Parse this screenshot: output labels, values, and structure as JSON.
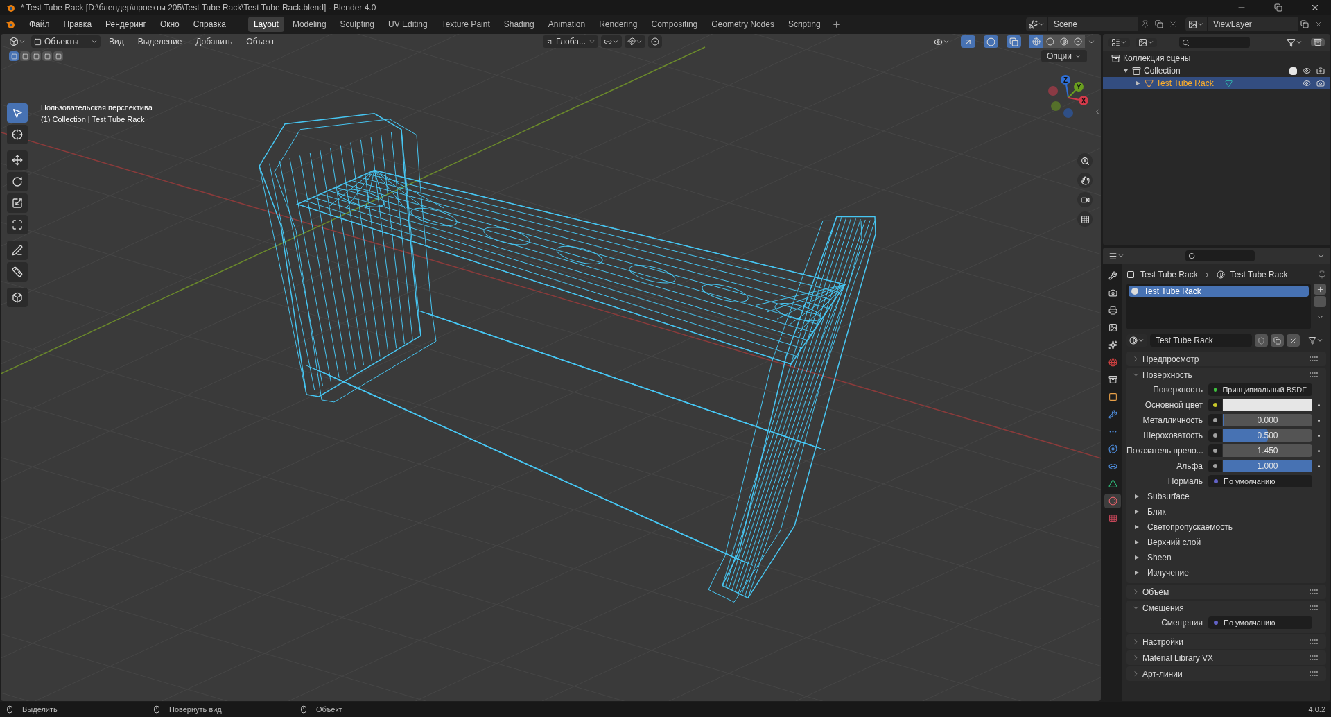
{
  "window": {
    "title": "* Test Tube Rack [D:\\блендер\\проекты 205\\Test Tube Rack\\Test Tube Rack.blend] - Blender 4.0"
  },
  "menu": [
    "Файл",
    "Правка",
    "Рендеринг",
    "Окно",
    "Справка"
  ],
  "workspaces": [
    {
      "label": "Layout",
      "selected": true
    },
    {
      "label": "Modeling",
      "selected": false
    },
    {
      "label": "Sculpting",
      "selected": false
    },
    {
      "label": "UV Editing",
      "selected": false
    },
    {
      "label": "Texture Paint",
      "selected": false
    },
    {
      "label": "Shading",
      "selected": false
    },
    {
      "label": "Animation",
      "selected": false
    },
    {
      "label": "Rendering",
      "selected": false
    },
    {
      "label": "Compositing",
      "selected": false
    },
    {
      "label": "Geometry Nodes",
      "selected": false
    },
    {
      "label": "Scripting",
      "selected": false
    }
  ],
  "scene": "Scene",
  "view_layer": "ViewLayer",
  "viewport": {
    "mode": "Объекты",
    "menus": [
      "Вид",
      "Выделение",
      "Добавить",
      "Объект"
    ],
    "orientation": "Глоба...",
    "options": "Опции",
    "toggles": [
      {
        "kind": "gizmo",
        "on": true
      },
      {
        "kind": "overlay",
        "on": true
      },
      {
        "kind": "xray",
        "on": true
      }
    ],
    "select_modes": [
      {
        "selected": true
      },
      {
        "selected": false
      },
      {
        "selected": false
      },
      {
        "selected": false
      },
      {
        "selected": false
      }
    ],
    "shading_modes": [
      {
        "kind": "wireframe",
        "selected": true
      },
      {
        "kind": "solid",
        "selected": false
      },
      {
        "kind": "material",
        "selected": false
      },
      {
        "kind": "rendered",
        "selected": false
      }
    ],
    "overlay_lines": [
      "Пользовательская перспектива",
      "(1) Collection | Test Tube Rack"
    ],
    "gizmo": {
      "x": "X",
      "y": "Y",
      "z": "Z"
    }
  },
  "tools": [
    {
      "kind": "select",
      "selected": true
    },
    {
      "kind": "cursor",
      "selected": false
    },
    {
      "kind": "move",
      "selected": false
    },
    {
      "kind": "rotate",
      "selected": false
    },
    {
      "kind": "scale",
      "selected": false
    },
    {
      "kind": "transform",
      "selected": false
    },
    {
      "kind": "annotate",
      "selected": false
    },
    {
      "kind": "measure",
      "selected": false
    },
    {
      "kind": "add",
      "selected": false
    }
  ],
  "outliner": {
    "root": "Коллекция сцены",
    "children": [
      {
        "label": "Collection",
        "selected": false,
        "expanded": true,
        "checked": true,
        "children": [
          {
            "label": "Test Tube Rack",
            "selected": true,
            "expanded": false
          }
        ]
      }
    ]
  },
  "properties": {
    "tabs": [
      {
        "kind": "tool",
        "selected": false
      },
      {
        "kind": "render",
        "selected": false
      },
      {
        "kind": "output",
        "selected": false
      },
      {
        "kind": "view_layer",
        "selected": false
      },
      {
        "kind": "scene",
        "selected": false
      },
      {
        "kind": "world",
        "selected": false
      },
      {
        "kind": "collection",
        "selected": false
      },
      {
        "kind": "object",
        "selected": false
      },
      {
        "kind": "modifiers",
        "selected": false
      },
      {
        "kind": "particles",
        "selected": false
      },
      {
        "kind": "physics",
        "selected": false
      },
      {
        "kind": "constraints",
        "selected": false
      },
      {
        "kind": "data",
        "selected": false
      },
      {
        "kind": "material",
        "selected": true
      },
      {
        "kind": "texture",
        "selected": false
      }
    ],
    "breadcrumb": [
      "Test Tube Rack",
      "Test Tube Rack"
    ],
    "slots": [
      {
        "label": "Test Tube Rack",
        "selected": true
      }
    ],
    "material": "Test Tube Rack",
    "panels": [
      {
        "title": "Предпросмотр",
        "expanded": false
      },
      {
        "title": "Поверхность",
        "expanded": true,
        "rows": [
          {
            "kind": "link",
            "color": "#3fc23f",
            "label": "Поверхность",
            "value": "Принципиальный BSDF"
          },
          {
            "kind": "swatch",
            "color": "#c7c729",
            "label": "Основной цвет",
            "swatch": {
              "color": "#e6e6e6"
            }
          },
          {
            "kind": "slider",
            "color": "#a1a1a1",
            "label": "Металличность",
            "value": "0.000",
            "level": 0
          },
          {
            "kind": "slider",
            "color": "#a1a1a1",
            "label": "Шероховатость",
            "value": "0.500",
            "level": 0.5
          },
          {
            "kind": "number",
            "color": "#a1a1a1",
            "label": "Показатель прело...",
            "value": "1.450"
          },
          {
            "kind": "slider",
            "color": "#a1a1a1",
            "label": "Альфа",
            "value": "1.000",
            "level": 1
          },
          {
            "kind": "link",
            "color": "#6363c7",
            "label": "Нормаль",
            "value": "По умолчанию"
          }
        ],
        "subpanels": [
          {
            "label": "Subsurface",
            "expanded": false
          },
          {
            "label": "Блик",
            "expanded": false
          },
          {
            "label": "Светопропускаемость",
            "expanded": false
          },
          {
            "label": "Верхний слой",
            "expanded": false
          },
          {
            "label": "Sheen",
            "expanded": false
          },
          {
            "label": "Излучение",
            "expanded": false
          }
        ]
      },
      {
        "title": "Объём",
        "expanded": false
      },
      {
        "title": "Смещения",
        "expanded": true,
        "rows": [
          {
            "kind": "link",
            "color": "#6363c7",
            "label": "Смещения",
            "value": "По умолчанию"
          }
        ]
      },
      {
        "title": "Настройки",
        "expanded": false
      },
      {
        "title": "Material Library VX",
        "expanded": false
      },
      {
        "title": "Арт-линии",
        "expanded": false
      }
    ]
  },
  "status_bar": {
    "hints": [
      "Выделить",
      "Повернуть вид",
      "Объект"
    ],
    "version": "4.0.2"
  }
}
